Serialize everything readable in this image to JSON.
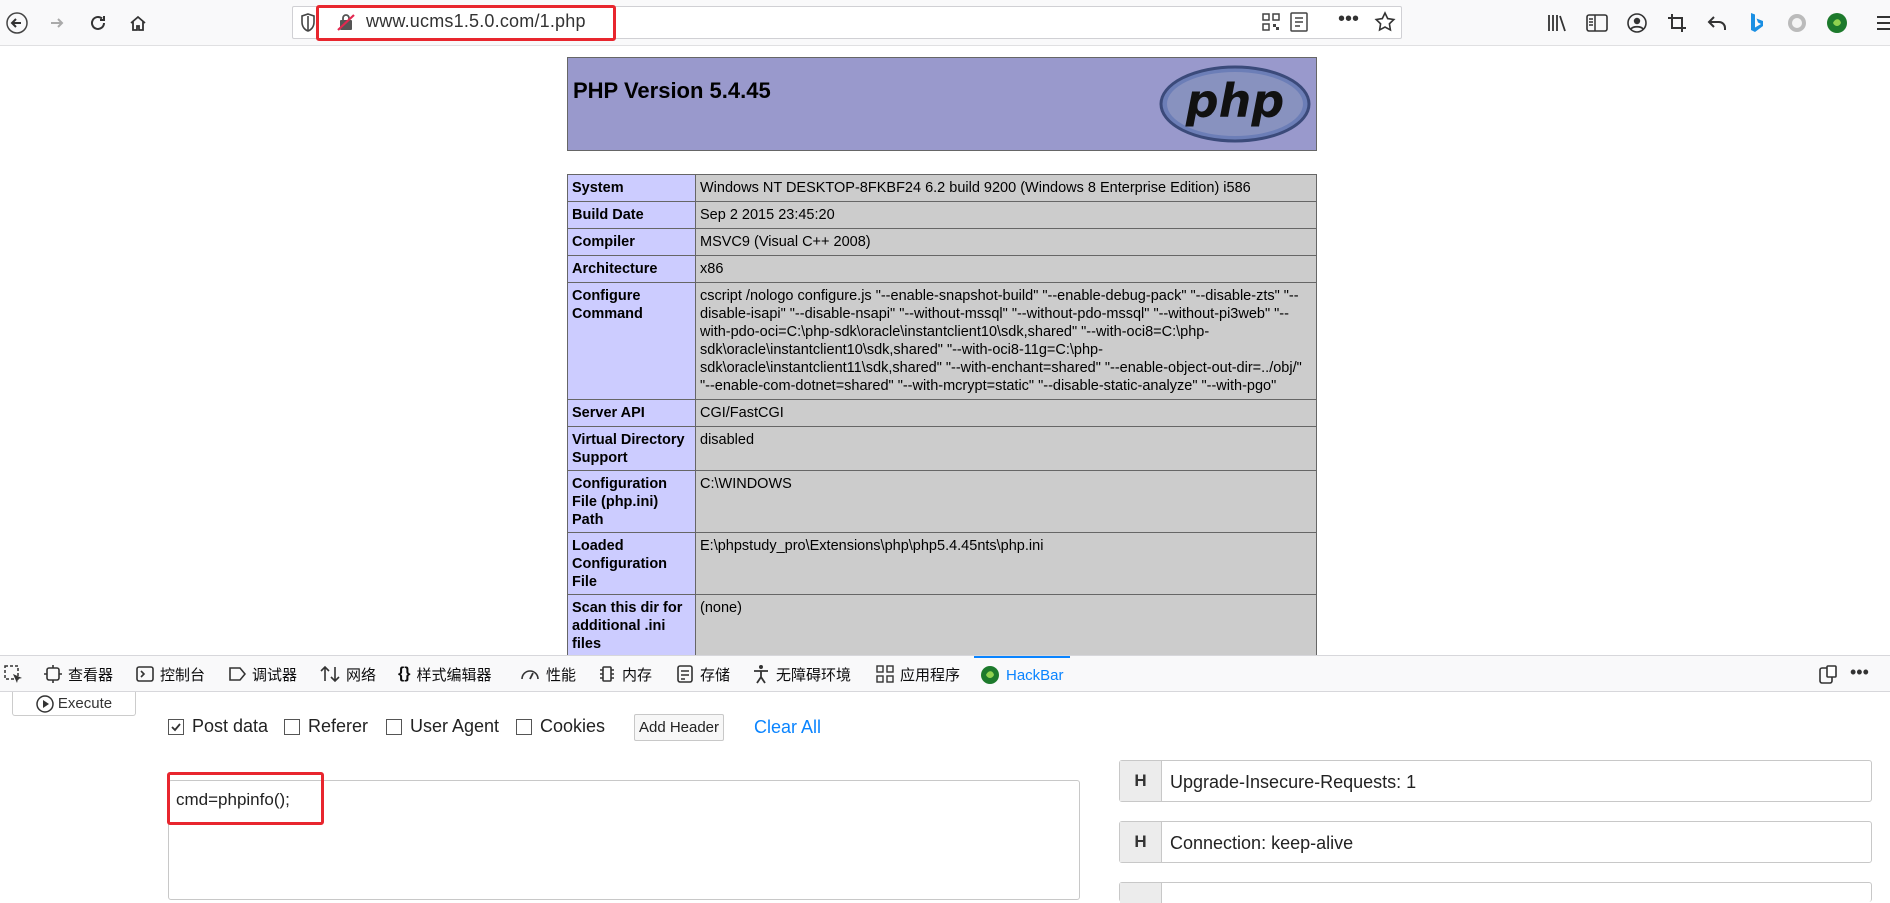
{
  "browser": {
    "url": "www.ucms1.5.0.com/1.php"
  },
  "page": {
    "php_title": "PHP Version 5.4.45",
    "logo_text": "php",
    "rows": [
      {
        "key": "System",
        "value": "Windows NT DESKTOP-8FKBF24 6.2 build 9200 (Windows 8 Enterprise Edition) i586"
      },
      {
        "key": "Build Date",
        "value": "Sep 2 2015 23:45:20"
      },
      {
        "key": "Compiler",
        "value": "MSVC9 (Visual C++ 2008)"
      },
      {
        "key": "Architecture",
        "value": "x86"
      },
      {
        "key": "Configure Command",
        "value": "cscript /nologo configure.js \"--enable-snapshot-build\" \"--enable-debug-pack\" \"--disable-zts\" \"--disable-isapi\" \"--disable-nsapi\" \"--without-mssql\" \"--without-pdo-mssql\" \"--without-pi3web\" \"--with-pdo-oci=C:\\php-sdk\\oracle\\instantclient10\\sdk,shared\" \"--with-oci8=C:\\php-sdk\\oracle\\instantclient10\\sdk,shared\" \"--with-oci8-11g=C:\\php-sdk\\oracle\\instantclient11\\sdk,shared\" \"--with-enchant=shared\" \"--enable-object-out-dir=../obj/\" \"--enable-com-dotnet=shared\" \"--with-mcrypt=static\" \"--disable-static-analyze\" \"--with-pgo\""
      },
      {
        "key": "Server API",
        "value": "CGI/FastCGI"
      },
      {
        "key": "Virtual Directory Support",
        "value": "disabled"
      },
      {
        "key": "Configuration File (php.ini) Path",
        "value": "C:\\WINDOWS"
      },
      {
        "key": "Loaded Configuration File",
        "value": "E:\\phpstudy_pro\\Extensions\\php\\php5.4.45nts\\php.ini"
      },
      {
        "key": "Scan this dir for additional .ini files",
        "value": "(none)"
      }
    ]
  },
  "devtools": {
    "tabs": [
      {
        "label": "查看器",
        "icon": "inspector-icon"
      },
      {
        "label": "控制台",
        "icon": "console-icon"
      },
      {
        "label": "调试器",
        "icon": "debugger-icon"
      },
      {
        "label": "网络",
        "icon": "network-icon"
      },
      {
        "label": "样式编辑器",
        "icon": "style-editor-icon"
      },
      {
        "label": "性能",
        "icon": "performance-icon"
      },
      {
        "label": "内存",
        "icon": "memory-icon"
      },
      {
        "label": "存储",
        "icon": "storage-icon"
      },
      {
        "label": "无障碍环境",
        "icon": "accessibility-icon"
      },
      {
        "label": "应用程序",
        "icon": "application-icon"
      },
      {
        "label": "HackBar",
        "icon": "hackbar-icon",
        "active": true
      }
    ]
  },
  "hackbar": {
    "execute": "Execute",
    "options": [
      {
        "label": "Post data",
        "checked": true
      },
      {
        "label": "Referer",
        "checked": false
      },
      {
        "label": "User Agent",
        "checked": false
      },
      {
        "label": "Cookies",
        "checked": false
      }
    ],
    "add_header": "Add Header",
    "clear_all": "Clear All",
    "post_body": "cmd=phpinfo();",
    "headers": [
      {
        "tag": "H",
        "value": "Upgrade-Insecure-Requests: 1"
      },
      {
        "tag": "H",
        "value": "Connection: keep-alive"
      }
    ]
  },
  "colors": {
    "accent": "#0a84ff",
    "highlight": "#e8262e",
    "php_header": "#9999cc",
    "php_key": "#ccccff",
    "php_value": "#cccccc"
  }
}
